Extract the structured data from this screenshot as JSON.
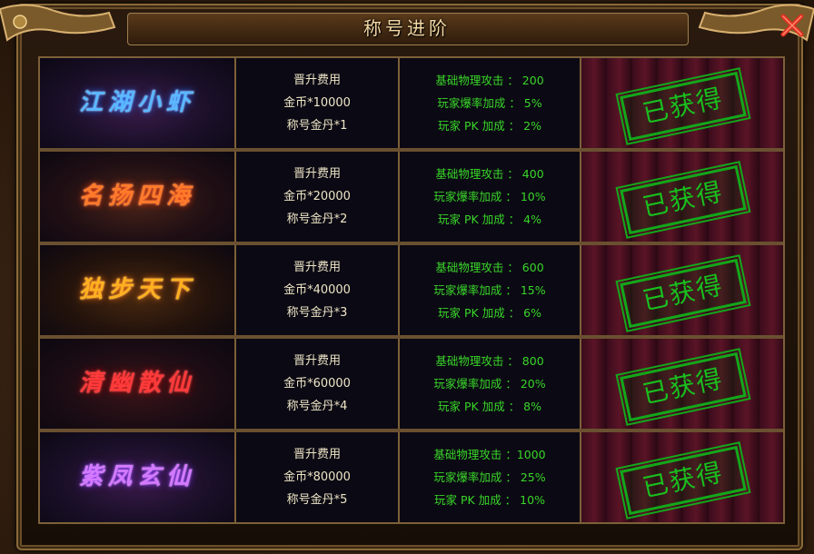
{
  "window": {
    "title": "称号进阶"
  },
  "rows": [
    {
      "name": "江湖小虾",
      "name_color": "#5ab8ff",
      "cost_label": "晋升费用",
      "cost_gold": "金币*10000",
      "cost_dan": "称号金丹*1",
      "stat1": "基础物理攻击 ： 200",
      "stat2": "玩家爆率加成 ： 5%",
      "stat3": "玩家 PK 加成 ： 2%",
      "status": "已获得"
    },
    {
      "name": "名扬四海",
      "name_color": "#ff7a2a",
      "cost_label": "晋升费用",
      "cost_gold": "金币*20000",
      "cost_dan": "称号金丹*2",
      "stat1": "基础物理攻击 ： 400",
      "stat2": "玩家爆率加成 ： 10%",
      "stat3": "玩家 PK 加成 ： 4%",
      "status": "已获得"
    },
    {
      "name": "独步天下",
      "name_color": "#ffb020",
      "cost_label": "晋升费用",
      "cost_gold": "金币*40000",
      "cost_dan": "称号金丹*3",
      "stat1": "基础物理攻击 ： 600",
      "stat2": "玩家爆率加成 ： 15%",
      "stat3": "玩家 PK 加成 ： 6%",
      "status": "已获得"
    },
    {
      "name": "清幽散仙",
      "name_color": "#ff3a3a",
      "cost_label": "晋升费用",
      "cost_gold": "金币*60000",
      "cost_dan": "称号金丹*4",
      "stat1": "基础物理攻击 ： 800",
      "stat2": "玩家爆率加成 ： 20%",
      "stat3": "玩家 PK 加成 ： 8%",
      "status": "已获得"
    },
    {
      "name": "紫凤玄仙",
      "name_color": "#d47aff",
      "cost_label": "晋升费用",
      "cost_gold": "金币*80000",
      "cost_dan": "称号金丹*5",
      "stat1": "基础物理攻击 ：1000",
      "stat2": "玩家爆率加成 ： 25%",
      "stat3": "玩家 PK 加成 ： 10%",
      "status": "已获得"
    }
  ],
  "icons": {
    "close": "close-x-icon"
  },
  "colors": {
    "stat_green": "#39d629",
    "stamp_green": "#19c01e",
    "gold_border": "#7c6038"
  }
}
